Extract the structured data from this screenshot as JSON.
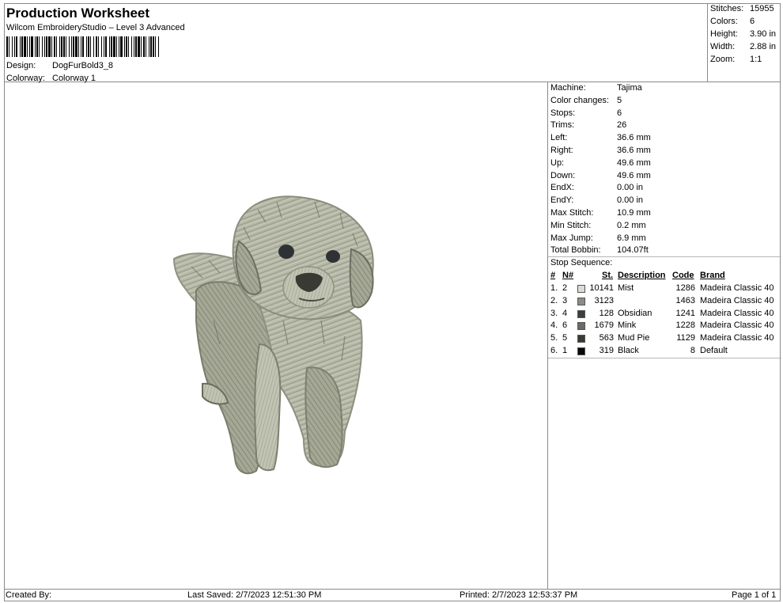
{
  "header": {
    "title": "Production Worksheet",
    "subtitle": "Wilcom EmbroideryStudio – Level 3 Advanced",
    "design_label": "Design:",
    "design_value": "DogFurBold3_8",
    "colorway_label": "Colorway:",
    "colorway_value": "Colorway 1"
  },
  "summary": [
    {
      "label": "Stitches:",
      "value": "15955"
    },
    {
      "label": "Colors:",
      "value": "6"
    },
    {
      "label": "Height:",
      "value": "3.90 in"
    },
    {
      "label": "Width:",
      "value": "2.88 in"
    },
    {
      "label": "Zoom:",
      "value": "1:1"
    }
  ],
  "machine_info": [
    {
      "label": "Machine:",
      "value": "Tajima"
    },
    {
      "label": "Color changes:",
      "value": "5"
    },
    {
      "label": "Stops:",
      "value": "6"
    },
    {
      "label": "Trims:",
      "value": "26"
    },
    {
      "label": "Left:",
      "value": "36.6 mm"
    },
    {
      "label": "Right:",
      "value": "36.6 mm"
    },
    {
      "label": "Up:",
      "value": "49.6 mm"
    },
    {
      "label": "Down:",
      "value": "49.6 mm"
    },
    {
      "label": "EndX:",
      "value": "0.00 in"
    },
    {
      "label": "EndY:",
      "value": "0.00 in"
    },
    {
      "label": "Max Stitch:",
      "value": "10.9 mm"
    },
    {
      "label": "Min Stitch:",
      "value": "0.2 mm"
    },
    {
      "label": "Max Jump:",
      "value": "6.9 mm"
    },
    {
      "label": "Total Bobbin:",
      "value": "104.07ft"
    }
  ],
  "stop_sequence": {
    "title": "Stop Sequence:",
    "headers": {
      "num": "#",
      "needle": "N#",
      "stitches": "St.",
      "description": "Description",
      "code": "Code",
      "brand": "Brand"
    },
    "rows": [
      {
        "num": "1.",
        "needle": "2",
        "stitches": "10141",
        "description": "Mist",
        "code": "1286",
        "brand": "Madeira Classic 40",
        "color": "#dcdcd6"
      },
      {
        "num": "2.",
        "needle": "3",
        "stitches": "3123",
        "description": "",
        "code": "1463",
        "brand": "Madeira Classic 40",
        "color": "#8c8c86"
      },
      {
        "num": "3.",
        "needle": "4",
        "stitches": "128",
        "description": "Obsidian",
        "code": "1241",
        "brand": "Madeira Classic 40",
        "color": "#3a3f40"
      },
      {
        "num": "4.",
        "needle": "6",
        "stitches": "1679",
        "description": "Mink",
        "code": "1228",
        "brand": "Madeira Classic 40",
        "color": "#6c6b66"
      },
      {
        "num": "5.",
        "needle": "5",
        "stitches": "563",
        "description": "Mud Pie",
        "code": "1129",
        "brand": "Madeira Classic 40",
        "color": "#3b3a34"
      },
      {
        "num": "6.",
        "needle": "1",
        "stitches": "319",
        "description": "Black",
        "code": "8",
        "brand": "Default",
        "color": "#0a0a0a"
      }
    ]
  },
  "footer": {
    "created_by": "Created By:",
    "last_saved": "Last Saved: 2/7/2023 12:51:30 PM",
    "printed": "Printed: 2/7/2023 12:53:37 PM",
    "page": "Page 1 of 1"
  },
  "design_colors": {
    "fur_light": "#b9bbaa",
    "fur_mid": "#9a9c8a",
    "fur_dark": "#6f7063",
    "eye": "#2e3234",
    "nose": "#3a3a34"
  }
}
